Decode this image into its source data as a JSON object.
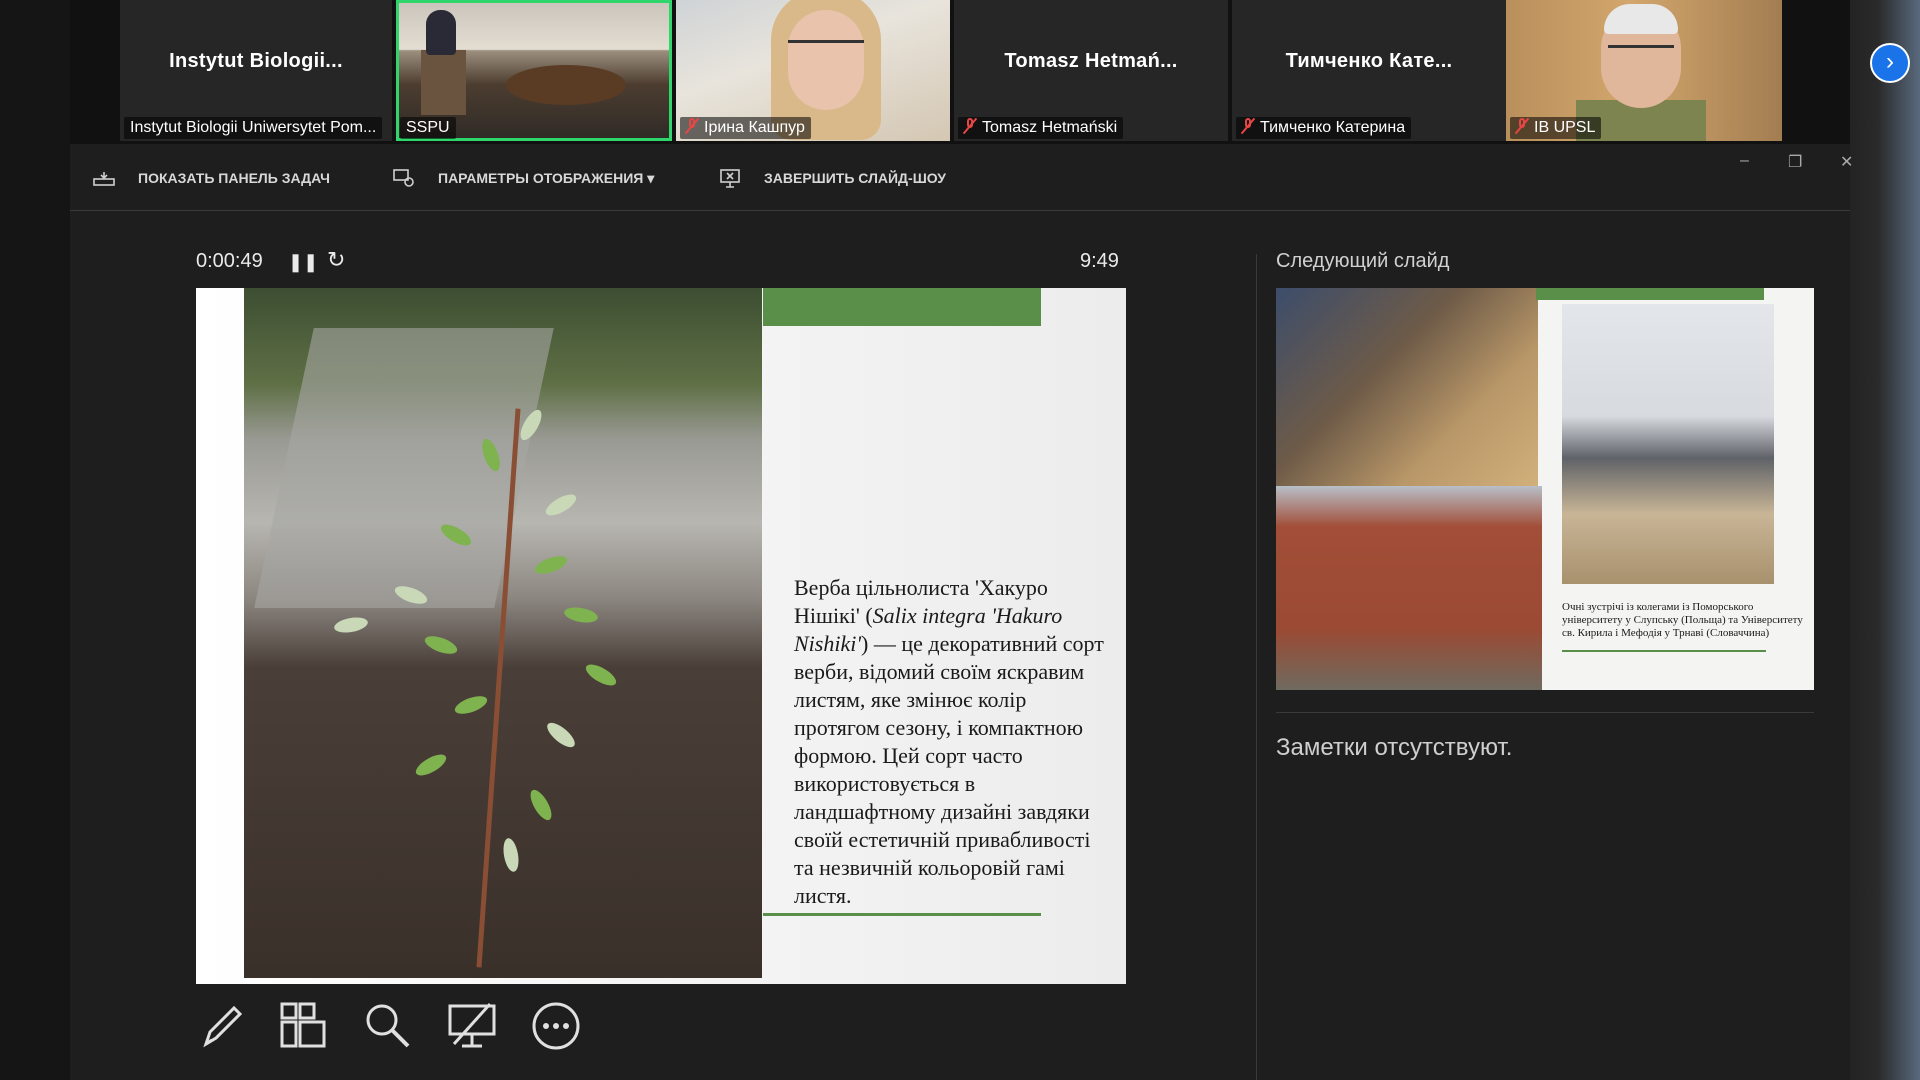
{
  "participants": [
    {
      "big_name": "Instytut  Biologii...",
      "label": "Instytut Biologii Uniwersytet Pom...",
      "muted": false,
      "video": false,
      "active": false
    },
    {
      "big_name": "",
      "label": "SSPU",
      "muted": false,
      "video": true,
      "active": true
    },
    {
      "big_name": "",
      "label": "Ірина Кашпур",
      "muted": true,
      "video": true,
      "active": false
    },
    {
      "big_name": "Tomasz  Hetmań...",
      "label": "Tomasz Hetmański",
      "muted": true,
      "video": false,
      "active": false
    },
    {
      "big_name": "Тимченко  Кате...",
      "label": "Тимченко Катерина",
      "muted": true,
      "video": false,
      "active": false
    },
    {
      "big_name": "",
      "label": "IB UPSL",
      "muted": true,
      "video": true,
      "active": false
    }
  ],
  "toolbar": {
    "show_taskbar": "ПОКАЗАТЬ ПАНЕЛЬ ЗАДАЧ",
    "display_settings": "ПАРАМЕТРЫ ОТОБРАЖЕНИЯ ▾",
    "end_show": "ЗАВЕРШИТЬ СЛАЙД-ШОУ",
    "minimize": "‒",
    "restore": "❐",
    "close": "✕"
  },
  "presenter": {
    "elapsed": "0:00:49",
    "clock": "9:49",
    "pause_icon": "❚❚",
    "restart_icon": "↻"
  },
  "current_slide": {
    "text_before": "Верба цільнолиста 'Хакуро Нішікі' (",
    "text_italic": "Salix integra 'Hakuro Nishiki'",
    "text_after": ") — це декоративний сорт верби, відомий своїм яскравим листям, яке змінює колір протягом сезону, і компактною формою. Цей сорт часто використовується в ландшафтному дизайні завдяки своїй естетичній привабливості та незвичній кольоровій гамі листя."
  },
  "next_slide": {
    "heading": "Следующий слайд",
    "caption": "Очні зустрічі із колегами із Поморського університету у Слупську (Польща) та Університету св. Кирила і Мефодія у Трнаві (Словаччина)"
  },
  "notes": {
    "empty_text": "Заметки отсутствуют."
  },
  "colors": {
    "accent_green": "#5a8f4a",
    "active_speaker": "#2fd66b",
    "next_button": "#1a73e8"
  }
}
